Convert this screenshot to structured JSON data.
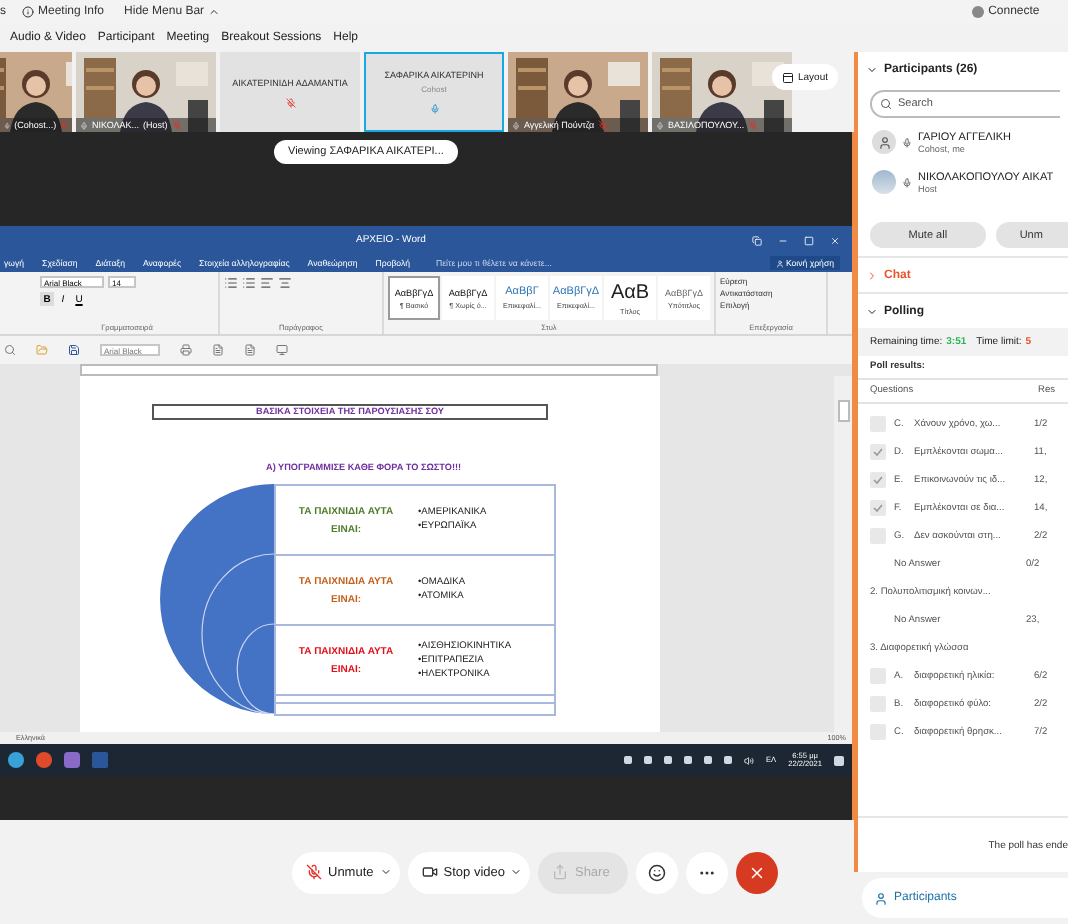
{
  "top_bar": {
    "cut_item": "s",
    "meeting_info": "Meeting Info",
    "hide_menu": "Hide Menu Bar",
    "status": "Connecte"
  },
  "menu": [
    "Audio & Video",
    "Participant",
    "Meeting",
    "Breakout Sessions",
    "Help"
  ],
  "videos": [
    {
      "kind": "video",
      "label": "(Cohost...)",
      "muted": true,
      "selected": false
    },
    {
      "kind": "video",
      "label": "ΝΙΚΟΛΑΚ...",
      "role": "(Host)",
      "muted": true,
      "selected": false
    },
    {
      "kind": "name",
      "name": "ΑΙΚΑΤΕΡΙΝΙΔΗ ΑΔΑΜΑΝΤΙΑ",
      "muted": true,
      "selected": false
    },
    {
      "kind": "name",
      "name": "ΣΑΦΑΡΙΚΑ ΑΙΚΑΤΕΡΙΝΗ",
      "role": "Cohost",
      "muted": false,
      "selected": true
    },
    {
      "kind": "video",
      "label": "Αγγελική Πούντζα",
      "muted": true,
      "selected": false
    },
    {
      "kind": "video",
      "label": "ΒΑΣΙΛΟΠΟΥΛΟΥ...",
      "muted": true,
      "selected": false
    }
  ],
  "layout_button": "Layout",
  "viewing": "Viewing ΣΑΦΑΡΙΚΑ ΑΙΚΑΤΕΡΙ...",
  "word": {
    "title": "ΑΡΧΕΙΟ - Word",
    "tabs": [
      "γωγή",
      "Σχεδίαση",
      "Διάταξη",
      "Αναφορές",
      "Στοιχεία αλληλογραφίας",
      "Αναθεώρηση",
      "Προβολή"
    ],
    "tell_me": "Πείτε μου τι θέλετε να κάνετε...",
    "share": "Κοινή χρήση",
    "font": "Arial Black",
    "size": "14",
    "format_buttons": [
      "B",
      "I",
      "U"
    ],
    "styles": [
      {
        "kind": "normal",
        "sample": "ΑαΒβΓγΔ",
        "name": "¶ Βασικό",
        "selected": true
      },
      {
        "kind": "normal",
        "sample": "ΑαΒβΓγΔ",
        "name": "¶ Χωρίς ό...",
        "selected": false
      },
      {
        "kind": "heading",
        "sample": "ΑαΒβΓ",
        "name": "Επικεφαλί...",
        "selected": false
      },
      {
        "kind": "heading",
        "sample": "ΑαΒβΓγΔ",
        "name": "Επικεφαλί...",
        "selected": false
      },
      {
        "kind": "title",
        "sample": "ΑαΒ",
        "name": "Τίτλος",
        "selected": false
      },
      {
        "kind": "subtitle",
        "sample": "ΑαΒβΓγΔ",
        "name": "Υπότιτλος",
        "selected": false
      }
    ],
    "editing": [
      "Εύρεση",
      "Αντικατάσταση",
      "Επιλογή"
    ],
    "groups": [
      "Γραμματοσειρά",
      "Παράγραφος",
      "Στυλ",
      "Επεξεργασία"
    ],
    "qat_font": "Arial Black",
    "language": "Ελληνικά",
    "zoom": "100%"
  },
  "document": {
    "heading": "ΒΑΣΙΚΑ ΣΤΟΙΧΕΙΑ ΤΗΣ ΠΑΡΟΥΣΙΑΣΗΣ ΣΟΥ",
    "instruction": "Α) ΥΠΟΓΡΑΜΜΙΣΕ   ΚΑΘΕ ΦΟΡΑ ΤΟ ΣΩΣΤΟ!!!",
    "rows": [
      {
        "label": "ΤΑ ΠΑΙΧΝΙΔΙΑ ΑΥΤΑ",
        "label2": "ΕΙΝΑΙ:",
        "color": "#4e7d2a",
        "options": [
          "•ΑΜΕΡΙΚΑΝΙΚΑ",
          "•ΕΥΡΩΠΑΪΚΑ"
        ]
      },
      {
        "label": "ΤΑ ΠΑΙΧΝΙΔΙΑ ΑΥΤΑ",
        "label2": "ΕΙΝΑΙ:",
        "color": "#c5601a",
        "options": [
          "•ΟΜΑΔΙΚΑ",
          "•ΑΤΟΜΙΚΑ"
        ]
      },
      {
        "label": "ΤΑ ΠΑΙΧΝΙΔΙΑ ΑΥΤΑ",
        "label2": "ΕΙΝΑΙ:",
        "color": "#e0101a",
        "options": [
          "•ΑΙΣΘΗΣΙΟΚΙΝΗΤΙΚΑ",
          "•ΕΠΙΤΡΑΠΕΖΙΑ",
          "•ΗΛΕΚΤΡΟΝΙΚΑ"
        ]
      }
    ]
  },
  "taskbar": {
    "time": "6:55 μμ",
    "date": "22/2/2021",
    "language": "ΕΛ"
  },
  "controls": [
    {
      "kind": "mic",
      "label": "Unmute",
      "disabled": false
    },
    {
      "kind": "video",
      "label": "Stop video",
      "disabled": false
    },
    {
      "kind": "share",
      "label": "Share",
      "disabled": true
    },
    {
      "kind": "reactions"
    },
    {
      "kind": "more"
    },
    {
      "kind": "leave"
    }
  ],
  "participants": {
    "title": "Participants (26)",
    "search_placeholder": "Search",
    "people": [
      {
        "kind": "icon",
        "name": "ΓΑΡΙΟΥ ΑΓΓΕΛΙΚΗ",
        "role": "Cohost, me"
      },
      {
        "name": "ΝΙΚΟΛΑΚΟΠΟΥΛΟΥ ΑΙΚΑΤ",
        "role": "Host"
      }
    ],
    "mute_all": "Mute all",
    "unmute_all": "Unm"
  },
  "chat": "Chat",
  "polling": {
    "title": "Polling",
    "remaining_label": "Remaining time:",
    "remaining": "3:51",
    "limit_label": "Time limit:",
    "limit": "5",
    "results_label": "Poll results:",
    "columns": [
      "Questions",
      "Res"
    ],
    "rows": [
      {
        "kind": "option",
        "letter": "C.",
        "text": "Χάνουν χρόνο, χω...",
        "result": "1/2",
        "checked": false
      },
      {
        "kind": "option",
        "letter": "D.",
        "text": "Εμπλέκονται σωμα...",
        "result": "11,",
        "checked": true
      },
      {
        "kind": "option",
        "letter": "E.",
        "text": "Επικοινωνούν τις ιδ...",
        "result": "12,",
        "checked": true
      },
      {
        "kind": "option",
        "letter": "F.",
        "text": "Εμπλέκονται σε δια...",
        "result": "14,",
        "checked": true
      },
      {
        "kind": "option",
        "letter": "G.",
        "text": "Δεν ασκούνται στη...",
        "result": "2/2",
        "checked": false
      },
      {
        "kind": "no_answer",
        "text": "No Answer",
        "result": "0/2"
      },
      {
        "kind": "question",
        "text": "2.  Πολυπολιτισμική κοινων..."
      },
      {
        "kind": "no_answer",
        "text": "No Answer",
        "result": "23,"
      },
      {
        "kind": "question",
        "text": "3.  Διαφορετική γλώσσα"
      },
      {
        "kind": "option",
        "letter": "A.",
        "text": "διαφορετική ηλικία:",
        "result": "6/2",
        "checked": false
      },
      {
        "kind": "option",
        "letter": "B.",
        "text": "διαφορετικό φύλο:",
        "result": "2/2",
        "checked": false
      },
      {
        "kind": "option",
        "letter": "C.",
        "text": "διαφορετική θρησκ...",
        "result": "7/2",
        "checked": false
      }
    ],
    "footer": "The poll has ende"
  },
  "participants_button": "Participants"
}
